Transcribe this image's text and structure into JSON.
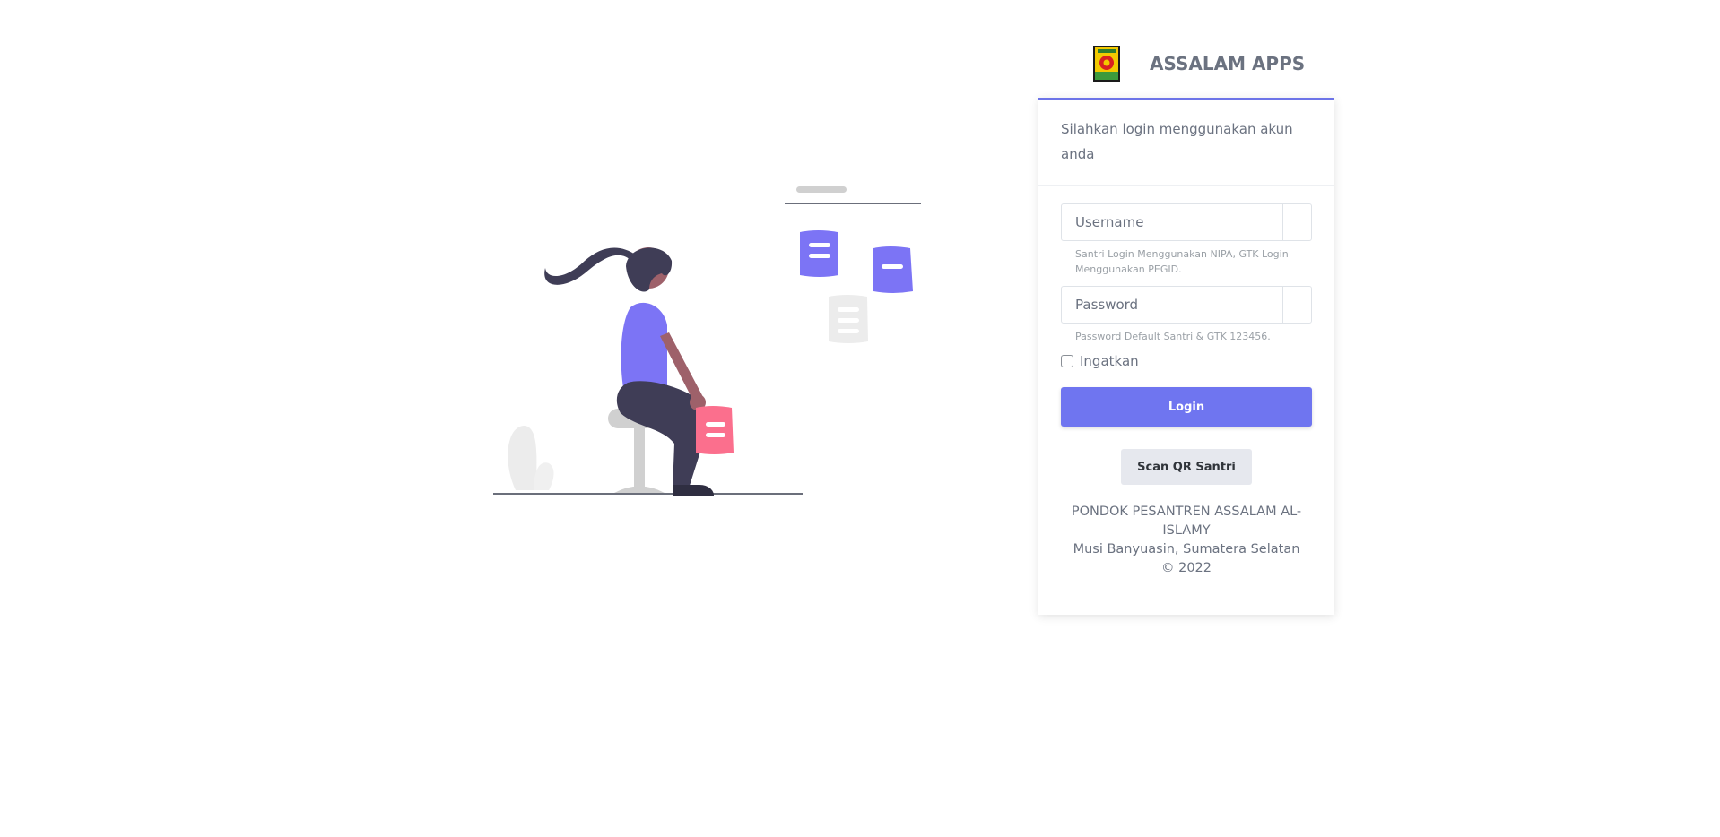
{
  "brand": {
    "app_name": "ASSALAM APPS",
    "logo_icon": "pesantren-emblem-icon"
  },
  "login_card": {
    "intro_text": "Silahkan login menggunakan akun anda",
    "username": {
      "placeholder": "Username",
      "value": "",
      "hint": "Santri Login Menggunakan NIPA, GTK Login Menggunakan PEGID."
    },
    "password": {
      "placeholder": "Password",
      "value": "",
      "hint": "Password Default Santri & GTK 123456."
    },
    "remember": {
      "label": "Ingatkan",
      "checked": false
    },
    "login_label": "Login",
    "scan_qr_label": "Scan QR Santri",
    "footer": {
      "line1": "PONDOK PESANTREN ASSALAM AL-ISLAMY",
      "line2": "Musi Banyuasin, Sumatera Selatan",
      "line3": "© 2022"
    }
  },
  "colors": {
    "accent": "#6f75f0",
    "illustration_purple": "#7c74f5",
    "illustration_pink": "#fb6f8d",
    "text": "#6b7280"
  }
}
